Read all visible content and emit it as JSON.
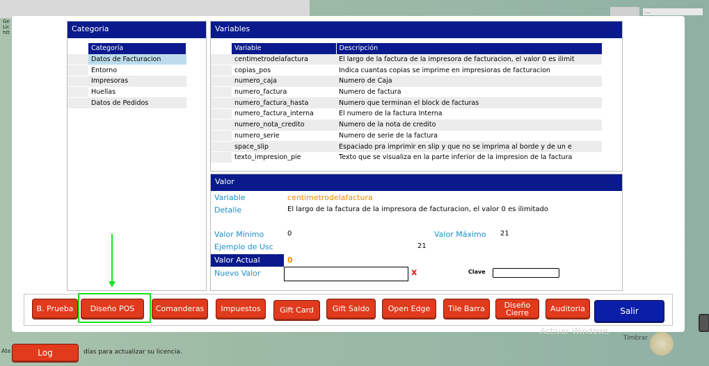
{
  "background": {
    "lefttext": "Ge\nLic\nhtt",
    "topright_dots": "....",
    "bottom_left_text": "Ate",
    "license_text": "días para actualizar su licencia.",
    "log_button": "Log",
    "watermark": "Activar Windows",
    "timbrar_text": "Timbrar"
  },
  "categoria": {
    "title": "Categoria",
    "column": "Categoría",
    "items": [
      "Datos de Facturacion",
      "Entorno",
      "Impresoras",
      "Huellas",
      "Datos de Pedidos"
    ],
    "selected_index": 0
  },
  "variables": {
    "title": "Variables",
    "columns": [
      "Variable",
      "Descripción"
    ],
    "rows": [
      [
        "centimetrodelafactura",
        "El largo de la factura de la impresora de facturacion, el valor 0 es ilimit"
      ],
      [
        "copias_pos",
        "Indica cuantas copias se imprime en impresioras de facturacion"
      ],
      [
        "numero_caja",
        "Numero de Caja"
      ],
      [
        "numero_factura",
        "Numero de factura"
      ],
      [
        "numero_factura_hasta",
        "Numero que terminan el block de facturas"
      ],
      [
        "numero_factura_interna",
        "El numero de la factura Interna"
      ],
      [
        "numero_nota_credito",
        "Numero de la nota de credito"
      ],
      [
        "numero_serie",
        "Numero de serie de la factura"
      ],
      [
        "space_slip",
        "Espaciado pra imprimir en slip y que no se imprima al borde y de un e"
      ],
      [
        "texto_impresion_pie",
        "Texto que se visualiza en la parte inferior de la impresion de la factura"
      ]
    ]
  },
  "valor": {
    "title": "Valor",
    "variable_label": "Variable",
    "variable_value": "centimetrodelafactura",
    "detalle_label": "Detalle",
    "detalle_value": "El largo de la factura de la impresora de facturacion, el valor 0 es ilimitado",
    "min_label": "Valor Mínimo",
    "min_value": "0",
    "max_label": "Valor Máximo",
    "max_value": "21",
    "ejemplo_label": "Ejemplo de Usc",
    "ejemplo_value": "21",
    "actual_label": "Valor Actual",
    "actual_value": "0",
    "nuevo_label": "Nuevo Valor",
    "nuevo_value": "",
    "clear_glyph": "x",
    "clave_label": "Clave",
    "clave_value": ""
  },
  "toolbar": {
    "b_prueba": "B. Prueba",
    "diseno_pos": "Diseño POS",
    "comanderas": "Comanderas",
    "impuestos": "Impuestos",
    "gift_card": "Gift Card",
    "gift_saldo": "Gift Saldo",
    "open_edge": "Open Edge",
    "tile_barra": "Tile Barra",
    "diseno_cierre_1": "Diseño",
    "diseno_cierre_2": "Cierre",
    "auditoria": "Auditoria",
    "salir": "Salir"
  },
  "colors": {
    "header_blue": "#0a1a8c",
    "button_red": "#e13a1c",
    "label_blue": "#1a8fc9",
    "accent_orange": "#f08a00",
    "highlight_green": "#17e21b"
  }
}
